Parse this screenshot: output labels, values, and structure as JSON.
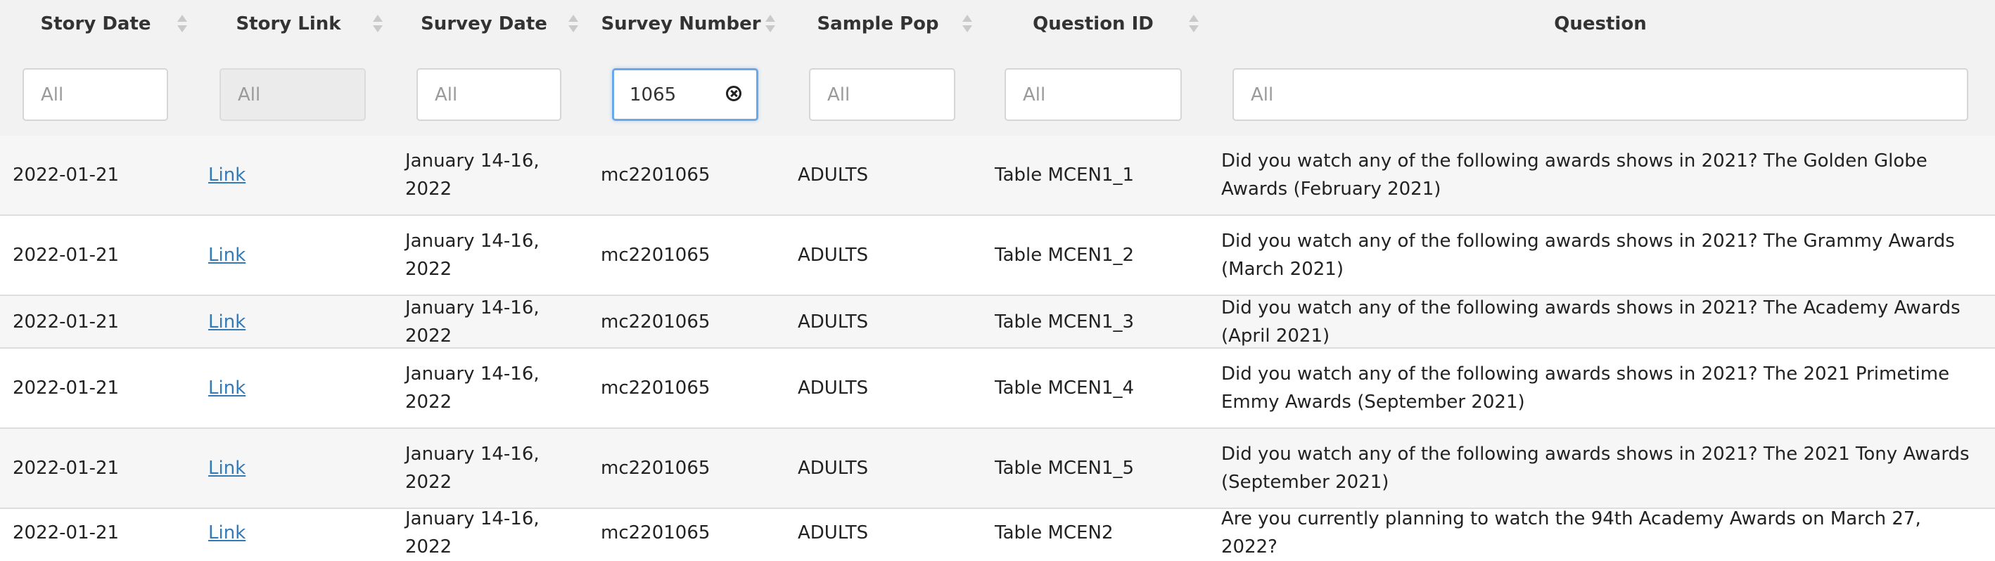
{
  "columns": [
    {
      "label": "Story Date",
      "filter_placeholder": "All",
      "filter_value": ""
    },
    {
      "label": "Story Link",
      "filter_placeholder": "All",
      "filter_value": ""
    },
    {
      "label": "Survey Date",
      "filter_placeholder": "All",
      "filter_value": ""
    },
    {
      "label": "Survey Number",
      "filter_placeholder": "All",
      "filter_value": "1065"
    },
    {
      "label": "Sample Pop",
      "filter_placeholder": "All",
      "filter_value": ""
    },
    {
      "label": "Question ID",
      "filter_placeholder": "All",
      "filter_value": ""
    },
    {
      "label": "Question",
      "filter_placeholder": "All",
      "filter_value": ""
    }
  ],
  "rows": [
    {
      "story_date": "2022-01-21",
      "story_link": "Link",
      "survey_date": "January 14-16, 2022",
      "survey_number": "mc2201065",
      "sample_pop": "ADULTS",
      "question_id": "Table MCEN1_1",
      "question": "Did you watch any of the following awards shows in 2021? The Golden Globe Awards (February 2021)"
    },
    {
      "story_date": "2022-01-21",
      "story_link": "Link",
      "survey_date": "January 14-16, 2022",
      "survey_number": "mc2201065",
      "sample_pop": "ADULTS",
      "question_id": "Table MCEN1_2",
      "question": "Did you watch any of the following awards shows in 2021? The Grammy Awards (March 2021)"
    },
    {
      "story_date": "2022-01-21",
      "story_link": "Link",
      "survey_date": "January 14-16, 2022",
      "survey_number": "mc2201065",
      "sample_pop": "ADULTS",
      "question_id": "Table MCEN1_3",
      "question": "Did you watch any of the following awards shows in 2021? The Academy Awards (April 2021)"
    },
    {
      "story_date": "2022-01-21",
      "story_link": "Link",
      "survey_date": "January 14-16, 2022",
      "survey_number": "mc2201065",
      "sample_pop": "ADULTS",
      "question_id": "Table MCEN1_4",
      "question": "Did you watch any of the following awards shows in 2021? The 2021 Primetime Emmy Awards (September 2021)"
    },
    {
      "story_date": "2022-01-21",
      "story_link": "Link",
      "survey_date": "January 14-16, 2022",
      "survey_number": "mc2201065",
      "sample_pop": "ADULTS",
      "question_id": "Table MCEN1_5",
      "question": "Did you watch any of the following awards shows in 2021? The 2021 Tony Awards (September 2021)"
    },
    {
      "story_date": "2022-01-21",
      "story_link": "Link",
      "survey_date": "January 14-16, 2022",
      "survey_number": "mc2201065",
      "sample_pop": "ADULTS",
      "question_id": "Table MCEN2",
      "question": "Are you currently planning to watch the 94th Academy Awards on March 27, 2022?"
    }
  ]
}
